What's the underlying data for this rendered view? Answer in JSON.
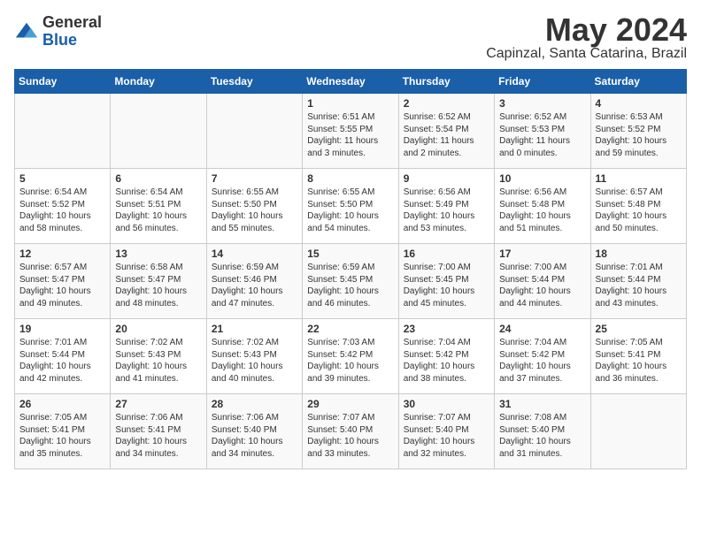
{
  "logo": {
    "general": "General",
    "blue": "Blue"
  },
  "title": "May 2024",
  "location": "Capinzal, Santa Catarina, Brazil",
  "headers": [
    "Sunday",
    "Monday",
    "Tuesday",
    "Wednesday",
    "Thursday",
    "Friday",
    "Saturday"
  ],
  "weeks": [
    [
      {
        "day": "",
        "info": ""
      },
      {
        "day": "",
        "info": ""
      },
      {
        "day": "",
        "info": ""
      },
      {
        "day": "1",
        "info": "Sunrise: 6:51 AM\nSunset: 5:55 PM\nDaylight: 11 hours and 3 minutes."
      },
      {
        "day": "2",
        "info": "Sunrise: 6:52 AM\nSunset: 5:54 PM\nDaylight: 11 hours and 2 minutes."
      },
      {
        "day": "3",
        "info": "Sunrise: 6:52 AM\nSunset: 5:53 PM\nDaylight: 11 hours and 0 minutes."
      },
      {
        "day": "4",
        "info": "Sunrise: 6:53 AM\nSunset: 5:52 PM\nDaylight: 10 hours and 59 minutes."
      }
    ],
    [
      {
        "day": "5",
        "info": "Sunrise: 6:54 AM\nSunset: 5:52 PM\nDaylight: 10 hours and 58 minutes."
      },
      {
        "day": "6",
        "info": "Sunrise: 6:54 AM\nSunset: 5:51 PM\nDaylight: 10 hours and 56 minutes."
      },
      {
        "day": "7",
        "info": "Sunrise: 6:55 AM\nSunset: 5:50 PM\nDaylight: 10 hours and 55 minutes."
      },
      {
        "day": "8",
        "info": "Sunrise: 6:55 AM\nSunset: 5:50 PM\nDaylight: 10 hours and 54 minutes."
      },
      {
        "day": "9",
        "info": "Sunrise: 6:56 AM\nSunset: 5:49 PM\nDaylight: 10 hours and 53 minutes."
      },
      {
        "day": "10",
        "info": "Sunrise: 6:56 AM\nSunset: 5:48 PM\nDaylight: 10 hours and 51 minutes."
      },
      {
        "day": "11",
        "info": "Sunrise: 6:57 AM\nSunset: 5:48 PM\nDaylight: 10 hours and 50 minutes."
      }
    ],
    [
      {
        "day": "12",
        "info": "Sunrise: 6:57 AM\nSunset: 5:47 PM\nDaylight: 10 hours and 49 minutes."
      },
      {
        "day": "13",
        "info": "Sunrise: 6:58 AM\nSunset: 5:47 PM\nDaylight: 10 hours and 48 minutes."
      },
      {
        "day": "14",
        "info": "Sunrise: 6:59 AM\nSunset: 5:46 PM\nDaylight: 10 hours and 47 minutes."
      },
      {
        "day": "15",
        "info": "Sunrise: 6:59 AM\nSunset: 5:45 PM\nDaylight: 10 hours and 46 minutes."
      },
      {
        "day": "16",
        "info": "Sunrise: 7:00 AM\nSunset: 5:45 PM\nDaylight: 10 hours and 45 minutes."
      },
      {
        "day": "17",
        "info": "Sunrise: 7:00 AM\nSunset: 5:44 PM\nDaylight: 10 hours and 44 minutes."
      },
      {
        "day": "18",
        "info": "Sunrise: 7:01 AM\nSunset: 5:44 PM\nDaylight: 10 hours and 43 minutes."
      }
    ],
    [
      {
        "day": "19",
        "info": "Sunrise: 7:01 AM\nSunset: 5:44 PM\nDaylight: 10 hours and 42 minutes."
      },
      {
        "day": "20",
        "info": "Sunrise: 7:02 AM\nSunset: 5:43 PM\nDaylight: 10 hours and 41 minutes."
      },
      {
        "day": "21",
        "info": "Sunrise: 7:02 AM\nSunset: 5:43 PM\nDaylight: 10 hours and 40 minutes."
      },
      {
        "day": "22",
        "info": "Sunrise: 7:03 AM\nSunset: 5:42 PM\nDaylight: 10 hours and 39 minutes."
      },
      {
        "day": "23",
        "info": "Sunrise: 7:04 AM\nSunset: 5:42 PM\nDaylight: 10 hours and 38 minutes."
      },
      {
        "day": "24",
        "info": "Sunrise: 7:04 AM\nSunset: 5:42 PM\nDaylight: 10 hours and 37 minutes."
      },
      {
        "day": "25",
        "info": "Sunrise: 7:05 AM\nSunset: 5:41 PM\nDaylight: 10 hours and 36 minutes."
      }
    ],
    [
      {
        "day": "26",
        "info": "Sunrise: 7:05 AM\nSunset: 5:41 PM\nDaylight: 10 hours and 35 minutes."
      },
      {
        "day": "27",
        "info": "Sunrise: 7:06 AM\nSunset: 5:41 PM\nDaylight: 10 hours and 34 minutes."
      },
      {
        "day": "28",
        "info": "Sunrise: 7:06 AM\nSunset: 5:40 PM\nDaylight: 10 hours and 34 minutes."
      },
      {
        "day": "29",
        "info": "Sunrise: 7:07 AM\nSunset: 5:40 PM\nDaylight: 10 hours and 33 minutes."
      },
      {
        "day": "30",
        "info": "Sunrise: 7:07 AM\nSunset: 5:40 PM\nDaylight: 10 hours and 32 minutes."
      },
      {
        "day": "31",
        "info": "Sunrise: 7:08 AM\nSunset: 5:40 PM\nDaylight: 10 hours and 31 minutes."
      },
      {
        "day": "",
        "info": ""
      }
    ]
  ]
}
